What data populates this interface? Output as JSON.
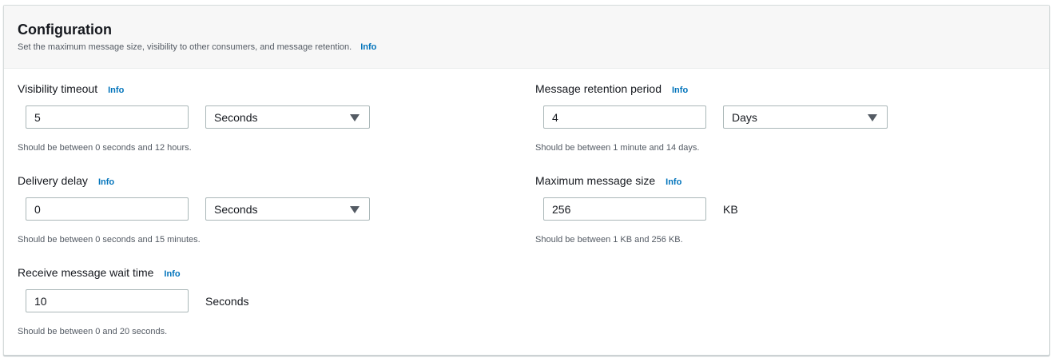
{
  "panel": {
    "title": "Configuration",
    "description": "Set the maximum message size, visibility to other consumers, and message retention.",
    "info": "Info"
  },
  "fields": {
    "visibility_timeout": {
      "label": "Visibility timeout",
      "info": "Info",
      "value": "5",
      "unit": "Seconds",
      "hint": "Should be between 0 seconds and 12 hours."
    },
    "delivery_delay": {
      "label": "Delivery delay",
      "info": "Info",
      "value": "0",
      "unit": "Seconds",
      "hint": "Should be between 0 seconds and 15 minutes."
    },
    "receive_wait_time": {
      "label": "Receive message wait time",
      "info": "Info",
      "value": "10",
      "unit": "Seconds",
      "hint": "Should be between 0 and 20 seconds."
    },
    "retention_period": {
      "label": "Message retention period",
      "info": "Info",
      "value": "4",
      "unit": "Days",
      "hint": "Should be between 1 minute and 14 days."
    },
    "max_message_size": {
      "label": "Maximum message size",
      "info": "Info",
      "value": "256",
      "unit": "KB",
      "hint": "Should be between 1 KB and 256 KB."
    }
  },
  "colors": {
    "link": "#0073bb",
    "header_bg": "#f7f7f7",
    "border": "#aab7b8",
    "hint_text": "#545b64"
  }
}
